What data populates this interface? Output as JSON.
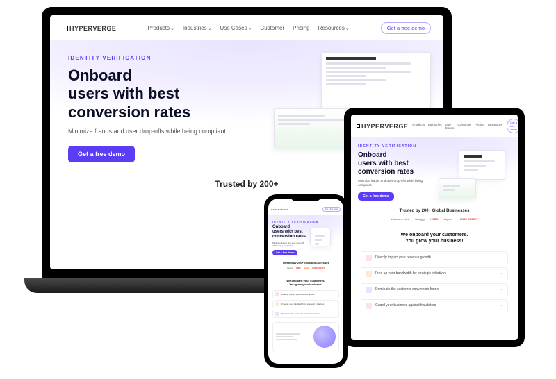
{
  "brand": "HYPERVERGE",
  "nav": {
    "items": [
      "Products",
      "Industries",
      "Use Cases",
      "Customer",
      "Pricing",
      "Resources"
    ],
    "cta": "Get a free demo"
  },
  "hero": {
    "eyebrow": "IDENTITY VERIFICATION",
    "line1": "Onboard",
    "line2": "users with best",
    "line3": "conversion rates",
    "sub": "Minimize frauds and user drop-offs while being compliant.",
    "cta": "Get a free demo"
  },
  "trusted": "Trusted by 200+ Global Businesses",
  "trusted_short": "Trusted by 200+",
  "logos": [
    "Vodafone Idea",
    "Swiggy",
    "HSBC",
    "Jupiter",
    "HOME CREDIT"
  ],
  "onboard": {
    "line1": "We onboard your customers.",
    "line2": "You grow your business!"
  },
  "features": [
    "Directly impact your revenue growth",
    "Free up your bandwidth for strategic initiatives",
    "Dominate the customer conversion funnel",
    "Guard your business against fraudsters"
  ]
}
